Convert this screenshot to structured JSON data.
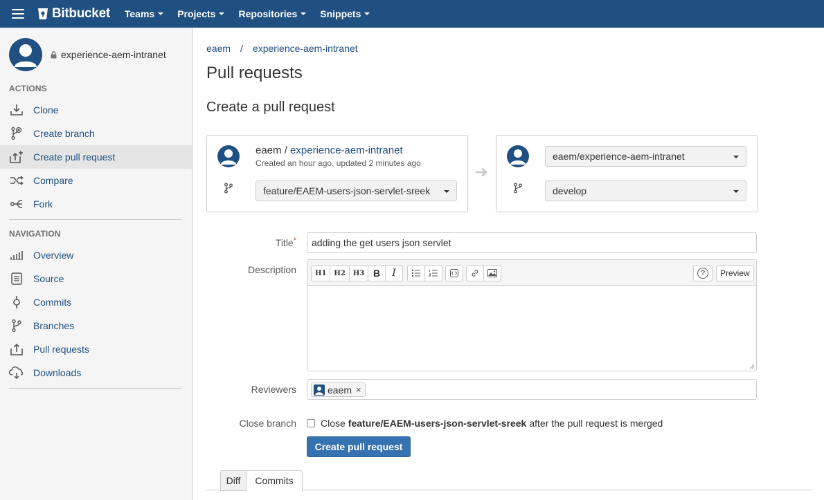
{
  "topbar": {
    "logo_text": "Bitbucket",
    "nav": [
      {
        "label": "Teams"
      },
      {
        "label": "Projects"
      },
      {
        "label": "Repositories"
      },
      {
        "label": "Snippets"
      }
    ],
    "brand_color": "#205081"
  },
  "sidebar": {
    "repo_name": "experience-aem-intranet",
    "actions_heading": "ACTIONS",
    "actions": [
      {
        "label": "Clone",
        "icon": "download-icon"
      },
      {
        "label": "Create branch",
        "icon": "create-branch-icon"
      },
      {
        "label": "Create pull request",
        "icon": "create-pull-request-icon",
        "active": true
      },
      {
        "label": "Compare",
        "icon": "shuffle-icon"
      },
      {
        "label": "Fork",
        "icon": "fork-icon"
      }
    ],
    "navigation_heading": "NAVIGATION",
    "navigation": [
      {
        "label": "Overview",
        "icon": "bar-chart-icon"
      },
      {
        "label": "Source",
        "icon": "document-icon"
      },
      {
        "label": "Commits",
        "icon": "commit-icon"
      },
      {
        "label": "Branches",
        "icon": "branch-icon"
      },
      {
        "label": "Pull requests",
        "icon": "pull-request-icon"
      },
      {
        "label": "Downloads",
        "icon": "cloud-icon"
      }
    ]
  },
  "breadcrumb": {
    "owner": "eaem",
    "separator": "/",
    "repo": "experience-aem-intranet"
  },
  "page": {
    "title": "Pull requests",
    "subtitle": "Create a pull request"
  },
  "source": {
    "owner": "eaem",
    "slash": " / ",
    "repo": "experience-aem-intranet",
    "meta": "Created an hour ago, updated 2 minutes ago",
    "branch": "feature/EAEM-users-json-servlet-sreek"
  },
  "destination": {
    "repo": "eaem/experience-aem-intranet",
    "branch": "develop"
  },
  "form": {
    "title_label": "Title",
    "required_mark": "*",
    "title_value": "adding the get users json servlet",
    "description_label": "Description",
    "toolbar": {
      "h1": "H1",
      "h2": "H2",
      "h3": "H3",
      "bold": "B",
      "italic": "I",
      "help": "?",
      "preview": "Preview"
    },
    "reviewers_label": "Reviewers",
    "reviewer": "eaem",
    "reviewer_remove": "×",
    "close_branch_label": "Close branch",
    "close_prefix": "Close",
    "close_branch_name": "feature/EAEM-users-json-servlet-sreek",
    "close_suffix": "after the pull request is merged",
    "submit_label": "Create pull request"
  },
  "tabs": [
    {
      "label": "Diff"
    },
    {
      "label": "Commits"
    }
  ]
}
